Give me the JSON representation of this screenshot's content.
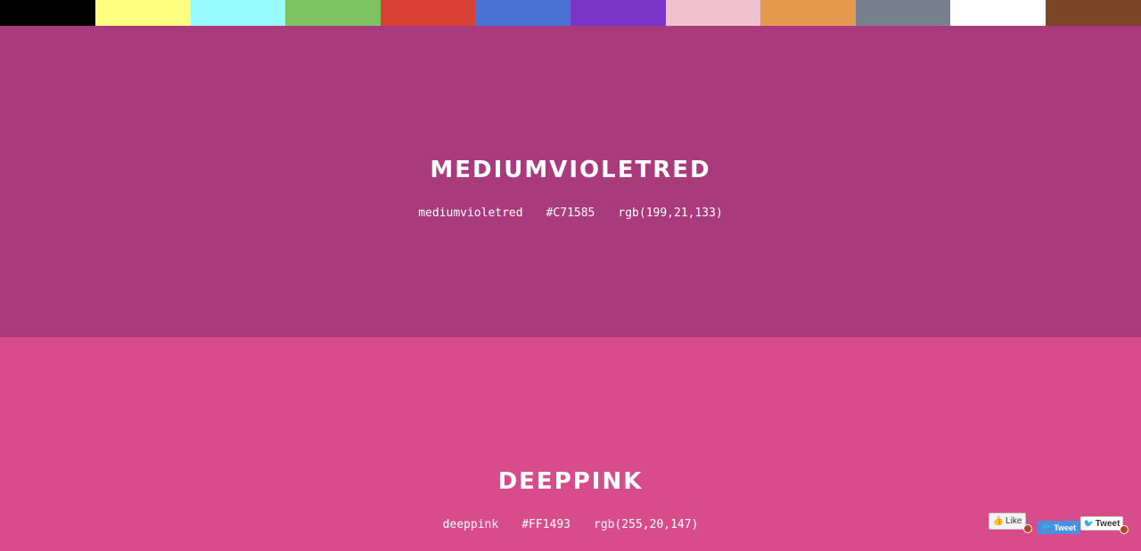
{
  "swatches": [
    {
      "color": "#000000",
      "name": "black"
    },
    {
      "color": "#ffff80",
      "name": "yellow"
    },
    {
      "color": "#98fcff",
      "name": "cyan"
    },
    {
      "color": "#7ec363",
      "name": "green"
    },
    {
      "color": "#d84133",
      "name": "red"
    },
    {
      "color": "#4a71d4",
      "name": "blue"
    },
    {
      "color": "#7a36c8",
      "name": "purple"
    },
    {
      "color": "#efc2cd",
      "name": "pink"
    },
    {
      "color": "#e69a4e",
      "name": "orange"
    },
    {
      "color": "#77818d",
      "name": "gray"
    },
    {
      "color": "#ffffff",
      "name": "white"
    },
    {
      "color": "#7a4627",
      "name": "brown"
    }
  ],
  "sections": [
    {
      "title": "MEDIUMVIOLETRED",
      "keyword": "mediumvioletred",
      "hex": "#C71585",
      "rgb": "rgb(199,21,133)",
      "background": "#a93a7c"
    },
    {
      "title": "DEEPPINK",
      "keyword": "deeppink",
      "hex": "#FF1493",
      "rgb": "rgb(255,20,147)",
      "background": "#d94c8b"
    }
  ],
  "social": {
    "like_label": "Like",
    "tweet_label_blue": "Tweet",
    "tweet_label_white": "Tweet"
  }
}
